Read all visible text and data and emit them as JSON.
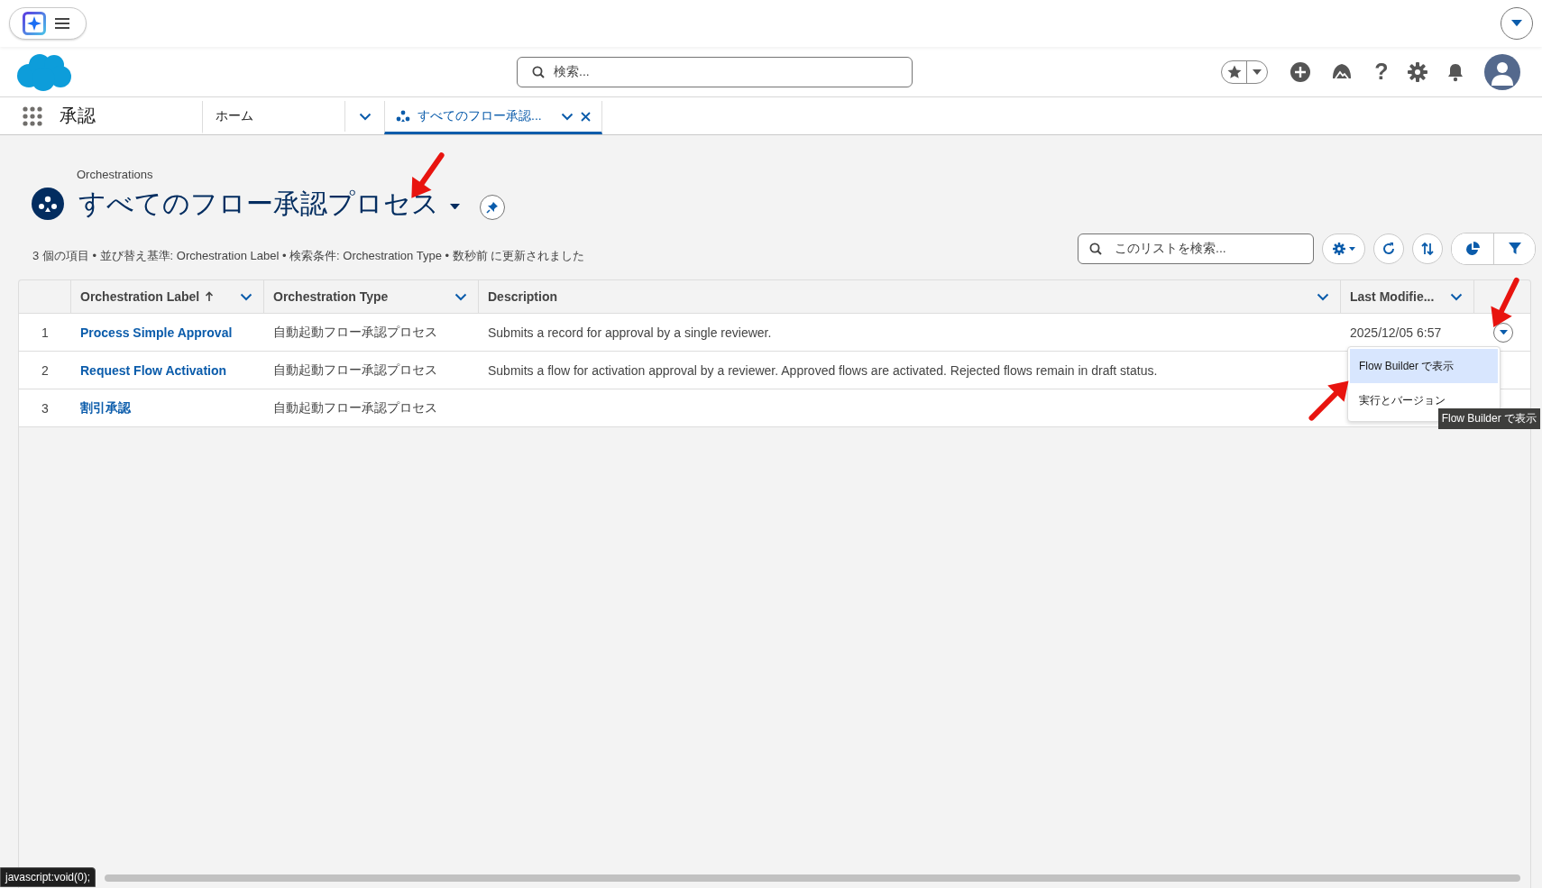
{
  "top_strip": {
    "expand_button": {
      "selected": false
    }
  },
  "header": {
    "search": {
      "placeholder": "検索..."
    },
    "help_glyph": "?"
  },
  "nav": {
    "app_name": "承認",
    "tabs": [
      {
        "label": "ホーム",
        "selected": false,
        "closable": false
      },
      {
        "label": "すべてのフロー承認...",
        "selected": true,
        "closable": true
      }
    ]
  },
  "list_header": {
    "object": "Orchestrations",
    "title": "すべてのフロー承認プロセス",
    "info": "3 個の項目 • 並び替え基準: Orchestration Label • 検索条件: Orchestration Type • 数秒前 に更新されました",
    "search": {
      "placeholder": "このリストを検索..."
    }
  },
  "table": {
    "columns": [
      {
        "label": "Orchestration Label",
        "sorted": true
      },
      {
        "label": "Orchestration Type",
        "sorted": false
      },
      {
        "label": "Description",
        "sorted": false
      },
      {
        "label": "Last Modifie...",
        "sorted": false
      }
    ],
    "rows": [
      {
        "number": "1",
        "label": "Process Simple Approval",
        "type": "自動起動フロー承認プロセス",
        "description": "Submits a record for approval by a single reviewer.",
        "last_modified": "2025/12/05 6:57",
        "menu_open": true
      },
      {
        "number": "2",
        "label": "Request Flow Activation",
        "type": "自動起動フロー承認プロセス",
        "description": "Submits a flow for activation approval by a reviewer. Approved flows are activated. Rejected flows remain in draft status.",
        "menu_open": false
      },
      {
        "number": "3",
        "label": "割引承認",
        "type": "自動起動フロー承認プロセス",
        "menu_open": false
      }
    ]
  },
  "row_menu": {
    "items": [
      {
        "label": "Flow Builder で表示",
        "selected": true
      },
      {
        "label": "実行とバージョン",
        "selected": false
      }
    ]
  },
  "tooltip": "Flow Builder で表示",
  "status_url": "javascript:void(0);",
  "annotations": [
    {
      "kind": "arrow"
    },
    {
      "kind": "arrow"
    },
    {
      "kind": "arrow"
    }
  ]
}
